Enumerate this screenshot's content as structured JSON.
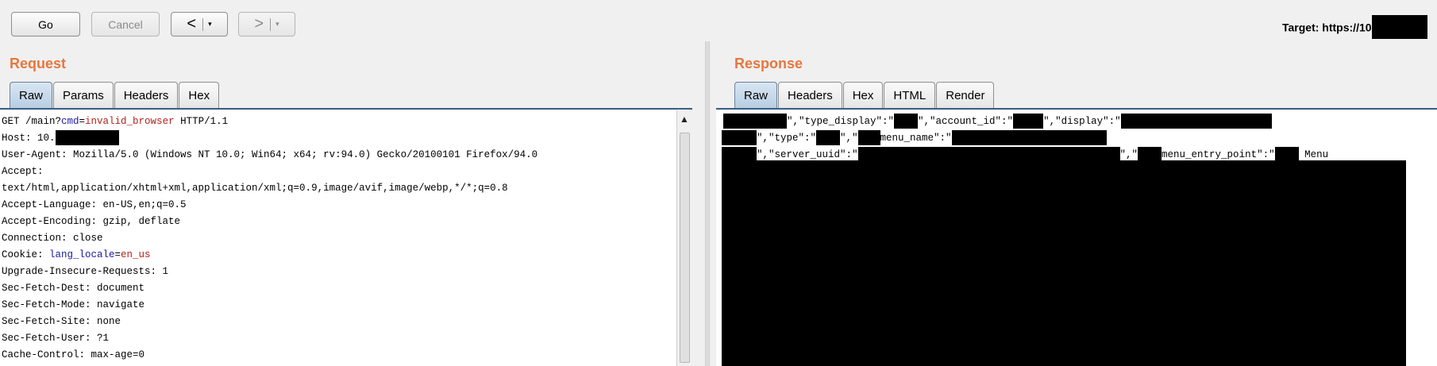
{
  "toolbar": {
    "go_label": "Go",
    "cancel_label": "Cancel",
    "back_label": "<",
    "forward_label": ">",
    "dropdown_caret": "▾",
    "target_label": "Target: https://10"
  },
  "request": {
    "title": "Request",
    "tabs": [
      "Raw",
      "Params",
      "Headers",
      "Hex"
    ],
    "active_tab": "Raw",
    "lines": {
      "l1_a": "GET /main?",
      "l1_param": "cmd",
      "l1_eq": "=",
      "l1_value": "invalid_browser",
      "l1_b": " HTTP/1.1",
      "l2": "Host: 10.",
      "l3": "User-Agent: Mozilla/5.0 (Windows NT 10.0; Win64; x64; rv:94.0) Gecko/20100101 Firefox/94.0",
      "l4": "Accept:",
      "l5": "text/html,application/xhtml+xml,application/xml;q=0.9,image/avif,image/webp,*/*;q=0.8",
      "l6": "Accept-Language: en-US,en;q=0.5",
      "l7": "Accept-Encoding: gzip, deflate",
      "l8": "Connection: close",
      "l9_a": "Cookie: ",
      "l9_name": "lang_locale",
      "l9_eq": "=",
      "l9_value": "en_us",
      "l10": "Upgrade-Insecure-Requests: 1",
      "l11": "Sec-Fetch-Dest: document",
      "l12": "Sec-Fetch-Mode: navigate",
      "l13": "Sec-Fetch-Site: none",
      "l14": "Sec-Fetch-User: ?1",
      "l15": "Cache-Control: max-age=0"
    }
  },
  "response": {
    "title": "Response",
    "tabs": [
      "Raw",
      "Headers",
      "Hex",
      "HTML",
      "Render"
    ],
    "active_tab": "Raw",
    "fragments": {
      "r1_a": "\",\"type_display\":\"",
      "r1_b": "\",\"account_id\":\"",
      "r1_c": "\",\"display\":\"",
      "r2_a": "\",\"type\":\"",
      "r2_b": "\",\"",
      "r2_c": "menu_name\":\"",
      "r3_a": "\",\"server_uuid\":\"",
      "r3_b": "\",\"",
      "r3_c": "menu_entry_point\":\"",
      "r3_d": "Menu"
    }
  },
  "colors": {
    "accent_orange": "#e8763d",
    "param_blue": "#1a1aa6",
    "value_red": "#b1221b",
    "tab_active": "#b8cde2",
    "redaction": "#000000"
  }
}
